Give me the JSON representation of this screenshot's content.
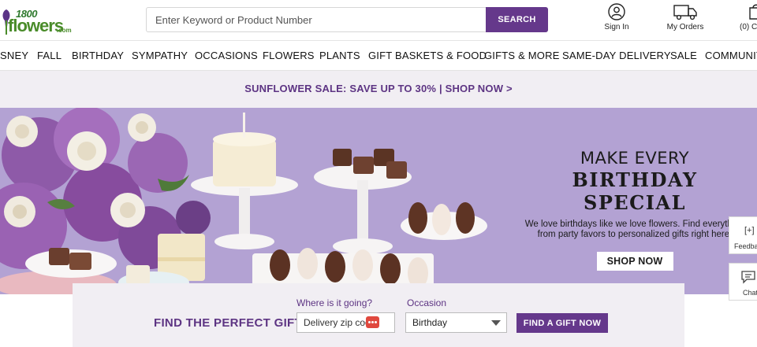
{
  "brand": {
    "logo_top": "1800",
    "logo_main": "flowers",
    "logo_suffix": ".com"
  },
  "search": {
    "placeholder": "Enter Keyword or Product Number",
    "button_label": "SEARCH"
  },
  "header_links": {
    "sign_in": "Sign In",
    "my_orders": "My Orders",
    "cart": "(0) C"
  },
  "nav": {
    "items": [
      "SNEY",
      "FALL",
      "BIRTHDAY",
      "SYMPATHY",
      "OCCASIONS",
      "FLOWERS",
      "PLANTS",
      "GIFT BASKETS & FOOD",
      "GIFTS & MORE",
      "SAME-DAY DELIVERY",
      "SALE",
      "COMMUNIT"
    ]
  },
  "promo": {
    "text": "SUNFLOWER SALE: SAVE UP TO 30% | SHOP NOW >"
  },
  "hero": {
    "line1": "MAKE EVERY",
    "line2": "BIRTHDAY SPECIAL",
    "body": "We love birthdays like we love flowers. Find everything from party favors to personalized gifts right here.",
    "button": "SHOP NOW"
  },
  "side_widgets": {
    "feedback": "Feedba",
    "feedback_icon": "[+]",
    "chat": "Chat"
  },
  "finder": {
    "title": "FIND THE PERFECT GIFT",
    "where_label": "Where is it going?",
    "zip_placeholder": "Delivery zip code",
    "occasion_label": "Occasion",
    "occasion_value": "Birthday",
    "button": "FIND A GIFT NOW"
  },
  "colors": {
    "brand_purple": "#65388b",
    "hero_lavender": "#b3a2d3",
    "logo_green": "#4a8c2a"
  }
}
